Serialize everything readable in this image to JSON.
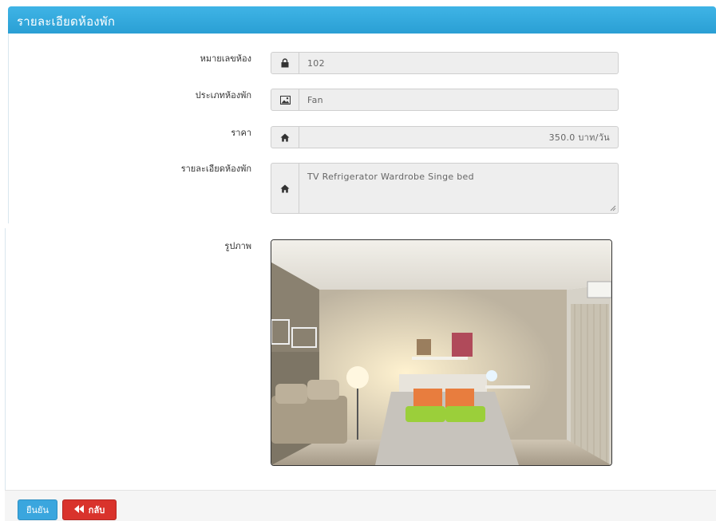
{
  "panel": {
    "title": "รายละเอียดห้องพัก"
  },
  "form": {
    "room_number": {
      "label": "หมายเลขห้อง",
      "value": "102",
      "icon": "lock-icon"
    },
    "room_type": {
      "label": "ประเภทห้องพัก",
      "value": "Fan",
      "icon": "picture-icon"
    },
    "price": {
      "label": "ราคา",
      "value": "350.0 บาท/วัน",
      "icon": "home-icon"
    },
    "details": {
      "label": "รายละเอียดห้องพัก",
      "value": "TV Refrigerator Wardrobe Singe bed",
      "icon": "home-icon"
    },
    "photo": {
      "label": "รูปภาพ"
    }
  },
  "buttons": {
    "confirm": "ยืนยัน",
    "back": "กลับ"
  },
  "colors": {
    "header": "#2a9fd4",
    "confirm": "#3aa6de",
    "back": "#d9332c"
  }
}
